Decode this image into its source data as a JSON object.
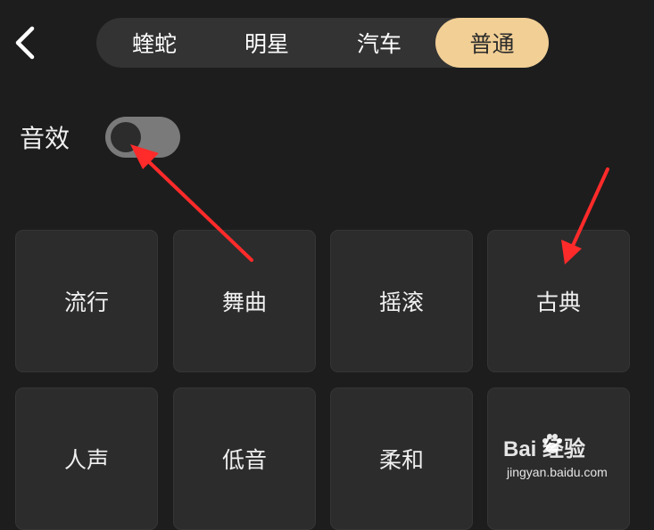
{
  "tabs": [
    {
      "label": "蝰蛇"
    },
    {
      "label": "明星"
    },
    {
      "label": "汽车"
    },
    {
      "label": "普通",
      "active": true
    }
  ],
  "sound_effect": {
    "label": "音效",
    "enabled": false
  },
  "presets": [
    {
      "label": "流行"
    },
    {
      "label": "舞曲"
    },
    {
      "label": "摇滚"
    },
    {
      "label": "古典"
    },
    {
      "label": "人声"
    },
    {
      "label": "低音"
    },
    {
      "label": "柔和"
    },
    {
      "label": ""
    }
  ],
  "watermark": {
    "main": "Bai  经验",
    "sub": "jingyan.baidu.com"
  },
  "colors": {
    "background": "#1d1d1d",
    "tab_bar": "#333333",
    "active_tab": "#f2cf95",
    "card": "#2c2c2c",
    "toggle_off": "#7a7a7a",
    "annotation_arrow": "#ff2a2a"
  },
  "icons": {
    "back": "chevron-left-icon",
    "watermark_logo": "paw-icon"
  }
}
